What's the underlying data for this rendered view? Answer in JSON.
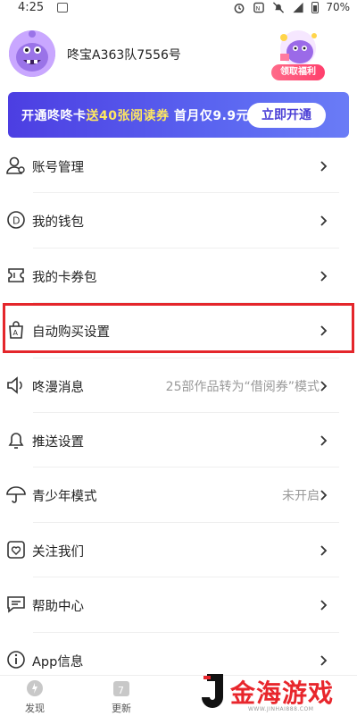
{
  "status_bar": {
    "time": "4:25",
    "battery": "70%",
    "icons": [
      "image-icon",
      "alarm-icon",
      "nfc-icon",
      "mute-icon",
      "signal-4g-icon",
      "battery-icon"
    ]
  },
  "profile": {
    "username": "咚宝A363队7556号",
    "welfare_label": "领取福利"
  },
  "vip_banner": {
    "text_prefix": "开通咚咚卡",
    "text_highlight": "送40张阅读券",
    "text_suffix": " 首月仅9.9元",
    "cta": "立即开通"
  },
  "menu": [
    {
      "label": "账号管理",
      "value": "",
      "icon": "user-icon"
    },
    {
      "label": "我的钱包",
      "value": "",
      "icon": "wallet-icon"
    },
    {
      "label": "我的卡券包",
      "value": "",
      "icon": "coupon-icon"
    },
    {
      "label": "自动购买设置",
      "value": "",
      "icon": "shopping-bag-icon"
    },
    {
      "label": "咚漫消息",
      "value": "25部作品转为“借阅券”模式",
      "icon": "speaker-icon"
    },
    {
      "label": "推送设置",
      "value": "",
      "icon": "bell-icon"
    },
    {
      "label": "青少年模式",
      "value": "未开启",
      "icon": "umbrella-icon"
    },
    {
      "label": "关注我们",
      "value": "",
      "icon": "heart-card-icon"
    },
    {
      "label": "帮助中心",
      "value": "",
      "icon": "chat-icon"
    },
    {
      "label": "App信息",
      "value": "",
      "icon": "info-icon"
    }
  ],
  "tabbar": [
    {
      "label": "发现",
      "icon": "discover-icon"
    },
    {
      "label": "更新",
      "icon": "calendar-icon",
      "badge": "7"
    }
  ],
  "watermark": {
    "text": "金海游戏",
    "url": "WWW.JINHAI888.COM"
  },
  "colors": {
    "vip_gradient_start": "#4c3ee2",
    "vip_highlight": "#ffe860",
    "highlight_box": "#e4262b",
    "watermark": "#e8262c"
  }
}
